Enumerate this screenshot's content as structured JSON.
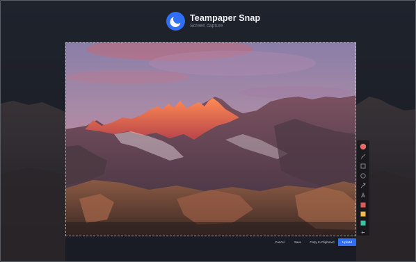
{
  "app": {
    "name": "Teampaper Snap",
    "subtitle": "Screen capture"
  },
  "icons": {
    "logo": "teampaper-moon-logo",
    "tools": [
      "record-dot-icon",
      "pen-line-icon",
      "rectangle-icon",
      "circle-icon",
      "arrow-icon",
      "text-icon",
      "swatch-red-icon",
      "swatch-yellow-icon",
      "swatch-teal-icon",
      "undo-icon"
    ]
  },
  "tool_colors": {
    "record": "#e56b6b",
    "red": "#e15a5a",
    "yellow": "#f0b94a",
    "teal": "#35c4a4"
  },
  "actions": {
    "cancel": "Cancel",
    "save": "Save",
    "copy": "Copy to Clipboard",
    "upload": "Upload"
  },
  "colors": {
    "accent": "#2f6ef5",
    "background": "#1b1e26"
  }
}
